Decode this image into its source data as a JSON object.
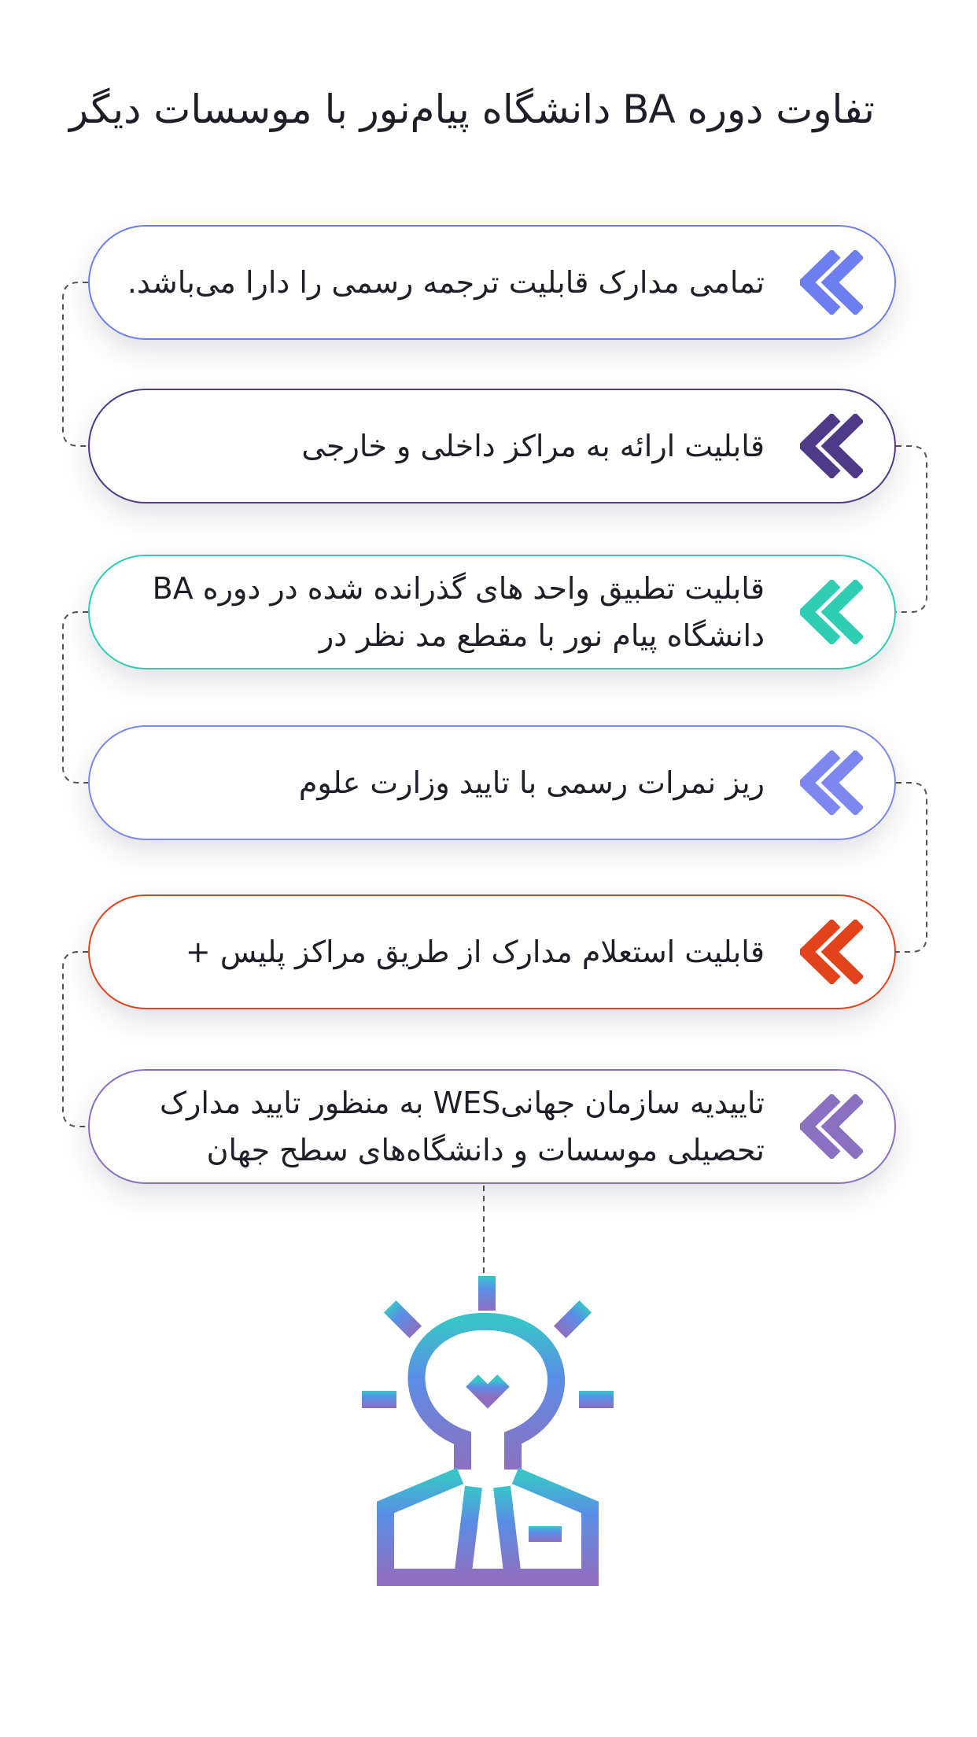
{
  "title": "تفاوت دوره BA دانشگاه پیام‌نور با موسسات دیگر",
  "colors": {
    "text": "#1e1e28",
    "connector": "#555555"
  },
  "items": [
    {
      "text": "تمامی مدارک قابلیت ترجمه رسمی را دارا می‌باشد.",
      "color": "#6d7ff0",
      "icon": "double-chevron-left-icon"
    },
    {
      "text": "قابلیت ارائه به مراکز داخلی و خارجی",
      "color": "#4e3a86",
      "icon": "double-chevron-left-icon"
    },
    {
      "text": "قابلیت تطبیق واحد های گذرانده شده در دوره BA دانشگاه پیام نور با مقطع مد نظر در",
      "color": "#2ecdb4",
      "icon": "double-chevron-left-icon"
    },
    {
      "text": "ریز نمرات رسمی با تایید وزارت علوم",
      "color": "#7c87ef",
      "icon": "double-chevron-left-icon"
    },
    {
      "text": "قابلیت استعلام مدارک از طریق مراکز پلیس +",
      "color": "#e2431c",
      "icon": "double-chevron-left-icon"
    },
    {
      "text": "تاییدیه سازمان جهانیWES به منظور تایید مدارک تحصیلی موسسات و دانشگاه‌های سطح جهان",
      "color": "#8b6fc0",
      "icon": "double-chevron-left-icon"
    }
  ],
  "illustration": {
    "icon": "lightbulb-person-icon"
  }
}
